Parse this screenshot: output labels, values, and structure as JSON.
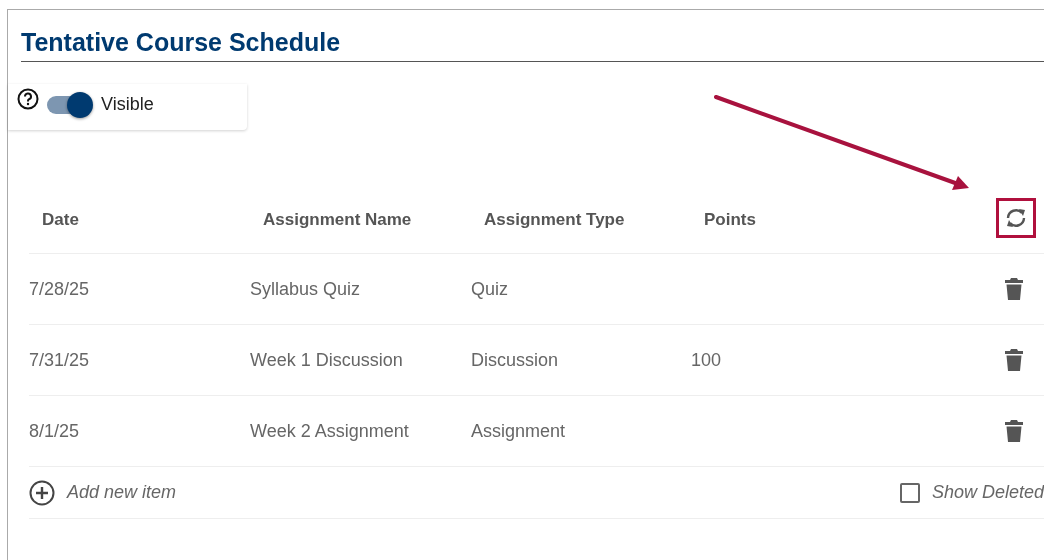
{
  "title": "Tentative Course Schedule",
  "visibility": {
    "label": "Visible",
    "on": true
  },
  "table": {
    "columns": [
      "Date",
      "Assignment Name",
      "Assignment Type",
      "Points"
    ],
    "rows": [
      {
        "cells": [
          "7/28/25",
          "Syllabus Quiz",
          "Quiz",
          ""
        ]
      },
      {
        "cells": [
          "7/31/25",
          "Week 1 Discussion",
          "Discussion",
          "100"
        ]
      },
      {
        "cells": [
          "8/1/25",
          "Week 2 Assignment",
          "Assignment",
          ""
        ]
      }
    ]
  },
  "add_item": "Add new item",
  "show_deleted": {
    "label": "Show Deleted",
    "checked": false
  }
}
